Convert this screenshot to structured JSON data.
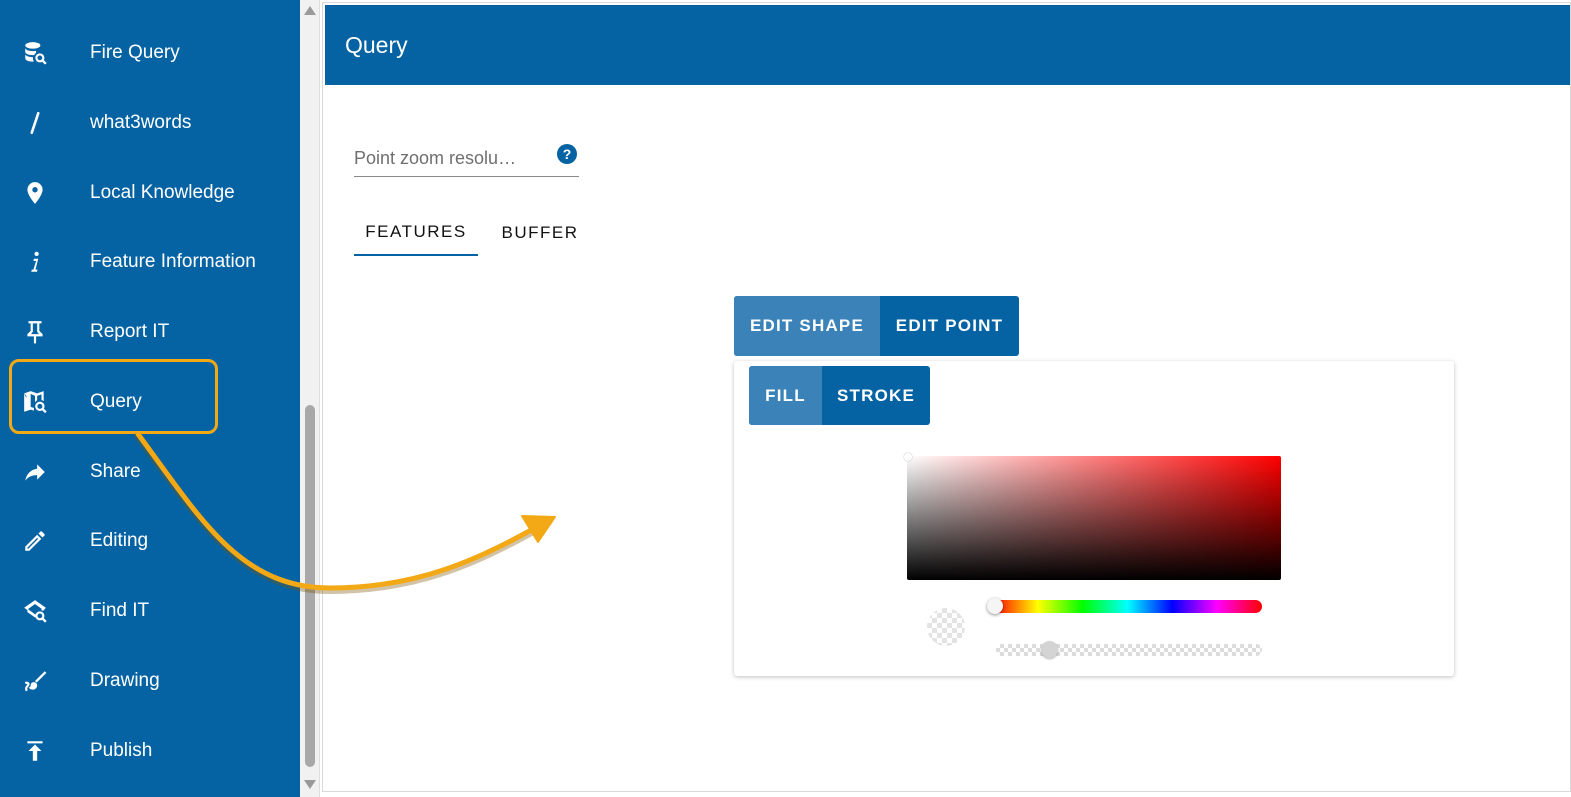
{
  "sidebar": {
    "items": [
      {
        "label": "Fire Query",
        "icon": "database-search-icon"
      },
      {
        "label": "what3words",
        "icon": "slash-icon"
      },
      {
        "label": "Local Knowledge",
        "icon": "map-pin-icon"
      },
      {
        "label": "Feature Information",
        "icon": "info-icon"
      },
      {
        "label": "Report IT",
        "icon": "pushpin-icon"
      },
      {
        "label": "Query",
        "icon": "map-search-icon",
        "highlighted": true
      },
      {
        "label": "Share",
        "icon": "share-arrow-icon"
      },
      {
        "label": "Editing",
        "icon": "pencil-icon"
      },
      {
        "label": "Find IT",
        "icon": "search-layers-icon"
      },
      {
        "label": "Drawing",
        "icon": "brush-icon"
      },
      {
        "label": "Publish",
        "icon": "upload-icon"
      }
    ]
  },
  "panel": {
    "title": "Query",
    "zoom_field": {
      "placeholder": "Point zoom resolu…",
      "value": ""
    },
    "help_icon_label": "?",
    "tabs": [
      {
        "label": "FEATURES",
        "active": true
      },
      {
        "label": "BUFFER",
        "active": false
      }
    ],
    "mode_buttons": [
      {
        "label": "EDIT SHAPE",
        "active": true
      },
      {
        "label": "EDIT POINT",
        "active": false
      }
    ],
    "style_buttons": [
      {
        "label": "FILL",
        "active": true
      },
      {
        "label": "STROKE",
        "active": false
      }
    ],
    "color_picker": {
      "hue_color": "#ff0000",
      "hue_position": 0.0,
      "alpha_position": 0.2
    }
  },
  "colors": {
    "primary": "#0563a3",
    "primary_active": "#3b82b8",
    "highlight": "#f2a915"
  }
}
